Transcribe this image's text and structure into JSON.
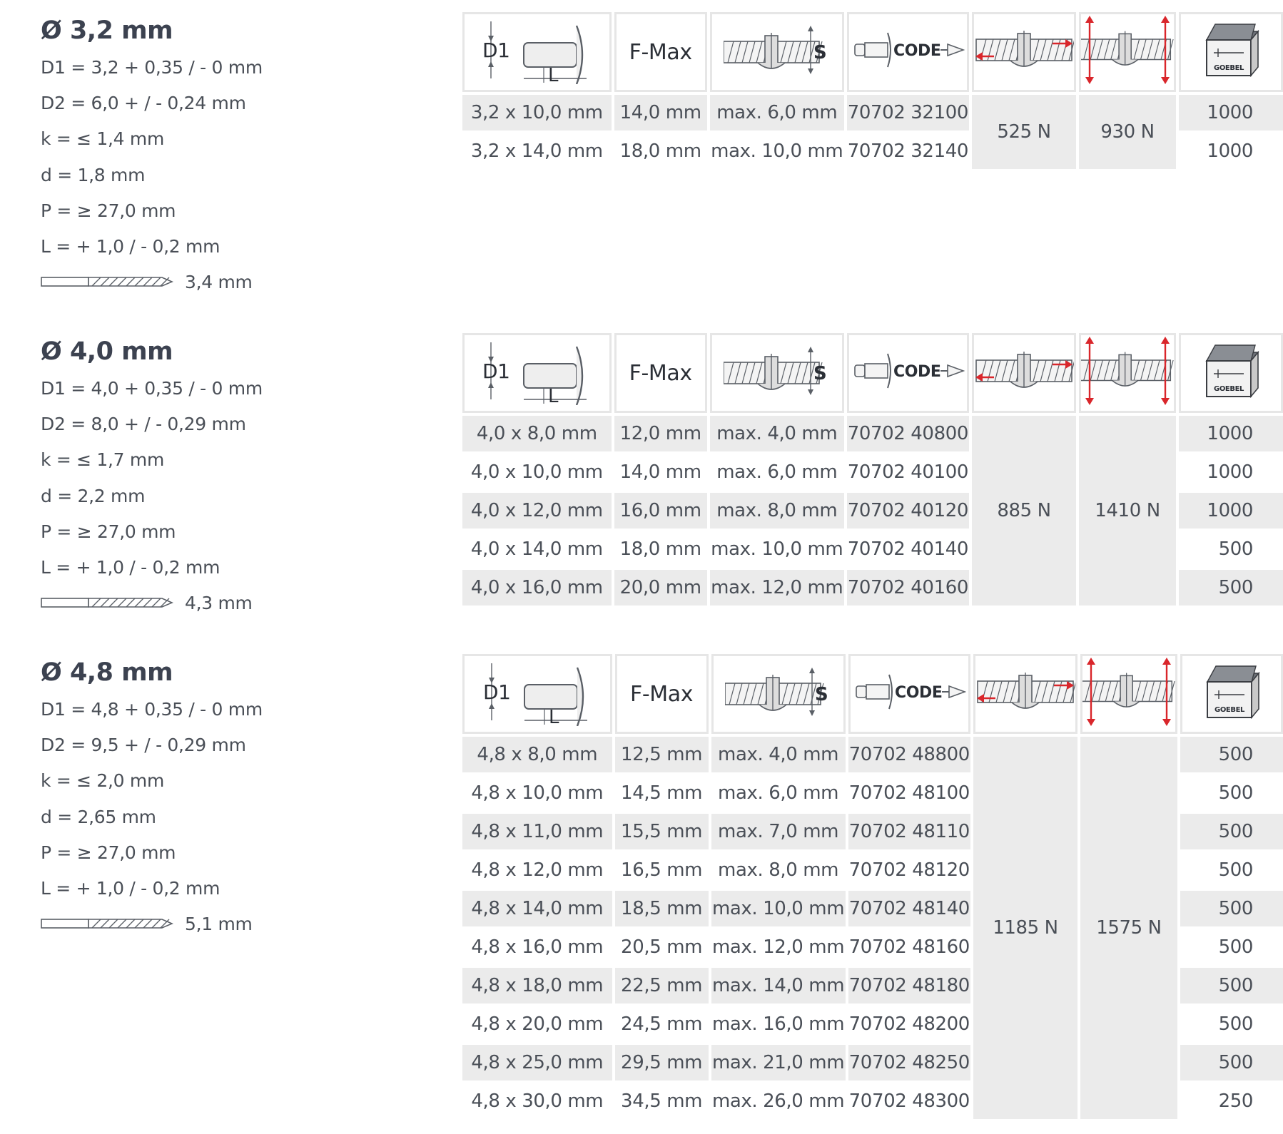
{
  "sections": [
    {
      "title": "Ø 3,2 mm",
      "specs": [
        "D1 = 3,2 + 0,35 / - 0 mm",
        "D2 = 6,0 + / - 0,24 mm",
        "k = ≤ 1,4 mm",
        "d = 1,8 mm",
        "P = ≥ 27,0 mm",
        "L = + 1,0 / - 0,2 mm"
      ],
      "drill": "3,4 mm",
      "headers": {
        "fmax": "F-Max",
        "code": "CODE",
        "d1": "D1",
        "l": "L",
        "s": "S",
        "brand": "GOEBEL"
      },
      "shear": "525 N",
      "tensile": "930 N",
      "rows": [
        {
          "size": "3,2 x 10,0 mm",
          "fmax": "14,0 mm",
          "grip": "max. 6,0 mm",
          "code": "70702 32100",
          "qty": "1000"
        },
        {
          "size": "3,2 x 14,0 mm",
          "fmax": "18,0 mm",
          "grip": "max. 10,0 mm",
          "code": "70702 32140",
          "qty": "1000"
        }
      ]
    },
    {
      "title": "Ø 4,0 mm",
      "specs": [
        "D1 = 4,0 + 0,35 / - 0 mm",
        "D2 = 8,0 + / - 0,29 mm",
        "k = ≤ 1,7 mm",
        "d = 2,2 mm",
        "P = ≥ 27,0 mm",
        "L = + 1,0 / - 0,2 mm"
      ],
      "drill": "4,3 mm",
      "headers": {
        "fmax": "F-Max",
        "code": "CODE",
        "d1": "D1",
        "l": "L",
        "s": "S",
        "brand": "GOEBEL"
      },
      "shear": "885 N",
      "tensile": "1410 N",
      "rows": [
        {
          "size": "4,0 x 8,0 mm",
          "fmax": "12,0 mm",
          "grip": "max. 4,0 mm",
          "code": "70702 40800",
          "qty": "1000"
        },
        {
          "size": "4,0 x 10,0 mm",
          "fmax": "14,0 mm",
          "grip": "max. 6,0 mm",
          "code": "70702 40100",
          "qty": "1000"
        },
        {
          "size": "4,0 x 12,0 mm",
          "fmax": "16,0 mm",
          "grip": "max. 8,0 mm",
          "code": "70702 40120",
          "qty": "1000"
        },
        {
          "size": "4,0 x 14,0 mm",
          "fmax": "18,0 mm",
          "grip": "max. 10,0 mm",
          "code": "70702 40140",
          "qty": "500"
        },
        {
          "size": "4,0 x 16,0 mm",
          "fmax": "20,0 mm",
          "grip": "max. 12,0 mm",
          "code": "70702 40160",
          "qty": "500"
        }
      ]
    },
    {
      "title": "Ø 4,8 mm",
      "specs": [
        "D1 = 4,8 + 0,35 / - 0 mm",
        "D2 = 9,5 + / - 0,29 mm",
        "k = ≤ 2,0 mm",
        "d = 2,65 mm",
        "P = ≥ 27,0 mm",
        "L = + 1,0 / - 0,2 mm"
      ],
      "drill": "5,1 mm",
      "headers": {
        "fmax": "F-Max",
        "code": "CODE",
        "d1": "D1",
        "l": "L",
        "s": "S",
        "brand": "GOEBEL"
      },
      "shear": "1185 N",
      "tensile": "1575 N",
      "rows": [
        {
          "size": "4,8 x 8,0 mm",
          "fmax": "12,5 mm",
          "grip": "max. 4,0 mm",
          "code": "70702 48800",
          "qty": "500"
        },
        {
          "size": "4,8 x 10,0 mm",
          "fmax": "14,5 mm",
          "grip": "max. 6,0 mm",
          "code": "70702 48100",
          "qty": "500"
        },
        {
          "size": "4,8 x 11,0 mm",
          "fmax": "15,5 mm",
          "grip": "max. 7,0 mm",
          "code": "70702 48110",
          "qty": "500"
        },
        {
          "size": "4,8 x 12,0 mm",
          "fmax": "16,5 mm",
          "grip": "max. 8,0 mm",
          "code": "70702 48120",
          "qty": "500"
        },
        {
          "size": "4,8 x 14,0 mm",
          "fmax": "18,5 mm",
          "grip": "max. 10,0 mm",
          "code": "70702 48140",
          "qty": "500"
        },
        {
          "size": "4,8 x 16,0 mm",
          "fmax": "20,5 mm",
          "grip": "max. 12,0 mm",
          "code": "70702 48160",
          "qty": "500"
        },
        {
          "size": "4,8 x 18,0 mm",
          "fmax": "22,5 mm",
          "grip": "max. 14,0 mm",
          "code": "70702 48180",
          "qty": "500"
        },
        {
          "size": "4,8 x 20,0 mm",
          "fmax": "24,5 mm",
          "grip": "max. 16,0 mm",
          "code": "70702 48200",
          "qty": "500"
        },
        {
          "size": "4,8 x 25,0 mm",
          "fmax": "29,5 mm",
          "grip": "max. 21,0 mm",
          "code": "70702 48250",
          "qty": "500"
        },
        {
          "size": "4,8 x 30,0 mm",
          "fmax": "34,5 mm",
          "grip": "max. 26,0 mm",
          "code": "70702 48300",
          "qty": "250"
        }
      ]
    }
  ],
  "colors": {
    "text": "#4a4f57",
    "title": "#3c4250",
    "row_alt": "#ebebeb",
    "border": "#e6e6e6",
    "arrow": "#d9262b"
  },
  "icons": [
    "rivet-dimension-icon",
    "grip-range-icon",
    "article-code-icon",
    "shear-force-icon",
    "tensile-force-icon",
    "package-box-icon",
    "drill-bit-icon"
  ]
}
